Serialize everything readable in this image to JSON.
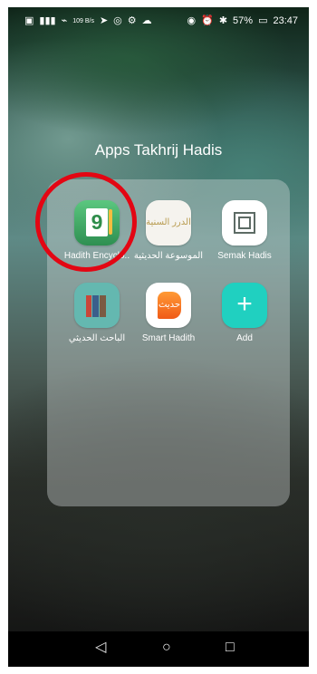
{
  "status_bar": {
    "left": [
      "SIM",
      "signal",
      "wifi",
      "109 B/s",
      "location",
      "whatsapp",
      "settings",
      "cloud"
    ],
    "right": [
      "eye",
      "alarm",
      "bluetooth",
      "57%",
      "23:47"
    ]
  },
  "folder": {
    "title": "Apps Takhrij Hadis",
    "apps": [
      {
        "label": "Hadith Encyclo..",
        "icon": "book-9-icon"
      },
      {
        "label": "الموسوعة الحديثية",
        "icon": "dorar-icon",
        "icon_text": "الدرر السنية"
      },
      {
        "label": "Semak Hadis",
        "icon": "semak-square-icon"
      },
      {
        "label": "الباحث الحديثي",
        "icon": "books-icon"
      },
      {
        "label": "Smart Hadith",
        "icon": "smart-hadith-icon",
        "icon_text": "حديث"
      },
      {
        "label": "Add",
        "icon": "plus-icon"
      }
    ]
  },
  "navigation": {
    "back": "◁",
    "home": "○",
    "recents": "□"
  }
}
